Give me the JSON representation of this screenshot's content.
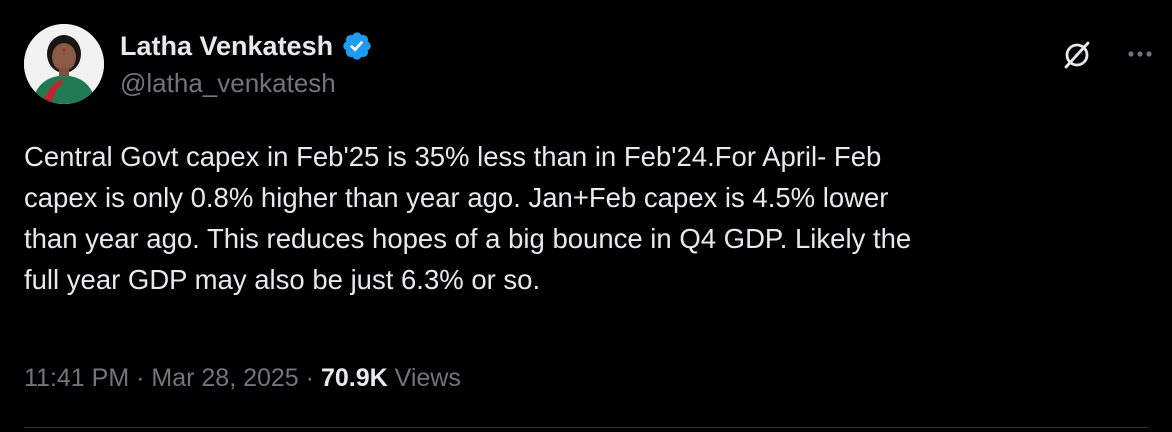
{
  "author": {
    "display_name": "Latha Venkatesh",
    "handle": "@latha_venkatesh",
    "verified": true,
    "verified_badge_color": "#1d9bf0"
  },
  "tweet": {
    "text": "Central Govt capex in Feb'25 is 35% less than in Feb'24.For April- Feb\ncapex is only 0.8% higher than year ago. Jan+Feb capex is 4.5% lower\nthan year ago. This reduces hopes of a big bounce in Q4 GDP. Likely the\nfull year GDP may also be just 6.3% or so.",
    "time": "11:41 PM",
    "separator": "·",
    "date": "Mar 28, 2025",
    "views_count": "70.9K",
    "views_label": "Views"
  },
  "actions": {
    "grok_icon": "grok-slash-icon",
    "more_icon": "more-horizontal-icon"
  },
  "colors": {
    "background": "#000000",
    "primary_text": "#e7e9ea",
    "secondary_text": "#71767b",
    "divider": "#2f3336"
  }
}
